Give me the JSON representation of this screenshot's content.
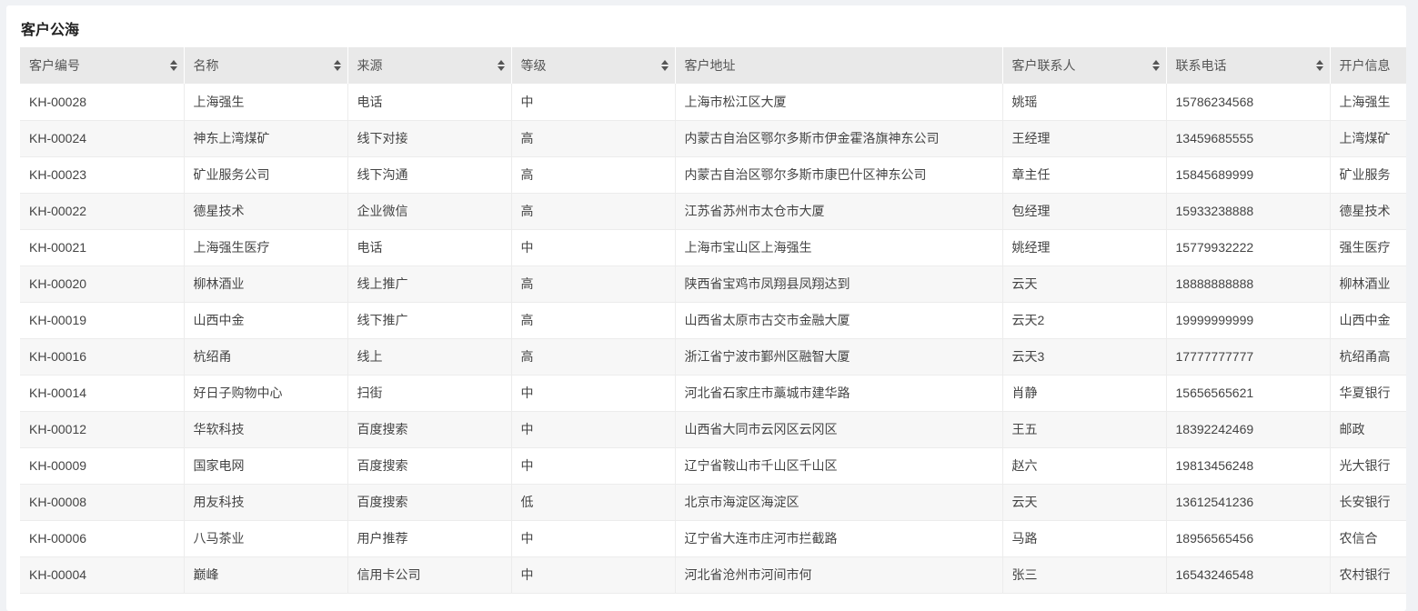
{
  "page": {
    "title": "客户公海"
  },
  "table": {
    "columns": [
      {
        "label": "客户编号",
        "sortable": true
      },
      {
        "label": "名称",
        "sortable": true
      },
      {
        "label": "来源",
        "sortable": true
      },
      {
        "label": "等级",
        "sortable": true
      },
      {
        "label": "客户地址",
        "sortable": false
      },
      {
        "label": "客户联系人",
        "sortable": true
      },
      {
        "label": "联系电话",
        "sortable": true
      },
      {
        "label": "开户信息",
        "sortable": false
      }
    ],
    "rows": [
      [
        "KH-00028",
        "上海强生",
        "电话",
        "中",
        "上海市松江区大厦",
        "姚瑶",
        "15786234568",
        "上海强生"
      ],
      [
        "KH-00024",
        "神东上湾煤矿",
        "线下对接",
        "高",
        "内蒙古自治区鄂尔多斯市伊金霍洛旗神东公司",
        "王经理",
        "13459685555",
        "上湾煤矿"
      ],
      [
        "KH-00023",
        "矿业服务公司",
        "线下沟通",
        "高",
        "内蒙古自治区鄂尔多斯市康巴什区神东公司",
        "章主任",
        "15845689999",
        "矿业服务"
      ],
      [
        "KH-00022",
        "德星技术",
        "企业微信",
        "高",
        "江苏省苏州市太仓市大厦",
        "包经理",
        "15933238888",
        "德星技术"
      ],
      [
        "KH-00021",
        "上海强生医疗",
        "电话",
        "中",
        "上海市宝山区上海强生",
        "姚经理",
        "15779932222",
        "强生医疗"
      ],
      [
        "KH-00020",
        "柳林酒业",
        "线上推广",
        "高",
        "陕西省宝鸡市凤翔县凤翔达到",
        "云天",
        "18888888888",
        "柳林酒业"
      ],
      [
        "KH-00019",
        "山西中金",
        "线下推广",
        "高",
        "山西省太原市古交市金融大厦",
        "云天2",
        "19999999999",
        "山西中金"
      ],
      [
        "KH-00016",
        "杭绍甬",
        "线上",
        "高",
        "浙江省宁波市鄞州区融智大厦",
        "云天3",
        "17777777777",
        "杭绍甬高"
      ],
      [
        "KH-00014",
        "好日子购物中心",
        "扫街",
        "中",
        "河北省石家庄市藁城市建华路",
        "肖静",
        "15656565621",
        "华夏银行"
      ],
      [
        "KH-00012",
        "华软科技",
        "百度搜索",
        "中",
        "山西省大同市云冈区云冈区",
        "王五",
        "18392242469",
        "邮政"
      ],
      [
        "KH-00009",
        "国家电网",
        "百度搜索",
        "中",
        "辽宁省鞍山市千山区千山区",
        "赵六",
        "19813456248",
        "光大银行"
      ],
      [
        "KH-00008",
        "用友科技",
        "百度搜索",
        "低",
        "北京市海淀区海淀区",
        "云天",
        "13612541236",
        "长安银行"
      ],
      [
        "KH-00006",
        "八马茶业",
        "用户推荐",
        "中",
        "辽宁省大连市庄河市拦截路",
        "马路",
        "18956565456",
        "农信合"
      ],
      [
        "KH-00004",
        "巅峰",
        "信用卡公司",
        "中",
        "河北省沧州市河间市何",
        "张三",
        "16543246548",
        "农村银行"
      ]
    ]
  }
}
